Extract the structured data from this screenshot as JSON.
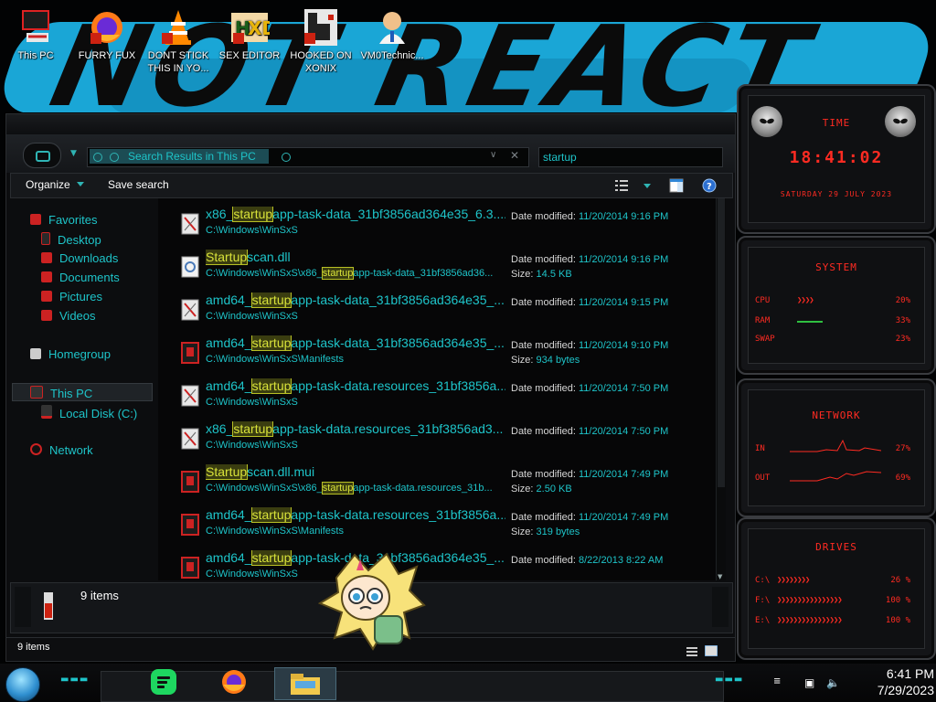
{
  "desktop": {
    "icons": [
      {
        "label": "This PC"
      },
      {
        "label": "FURRY FUX"
      },
      {
        "label": "DONT STICK THIS IN YO..."
      },
      {
        "label": "SEX EDITOR"
      },
      {
        "label": "HOOKED ON XONIX"
      },
      {
        "label": "VM0Technic..."
      }
    ]
  },
  "explorer": {
    "address_text": "Search Results in This PC",
    "search_value": "startup",
    "toolbar": {
      "organize": "Organize",
      "save_search": "Save search"
    },
    "nav": {
      "favorites": "Favorites",
      "desktop": "Desktop",
      "downloads": "Downloads",
      "documents": "Documents",
      "pictures": "Pictures",
      "videos": "Videos",
      "homegroup": "Homegroup",
      "this_pc": "This PC",
      "local_disk": "Local Disk (C:)",
      "network": "Network"
    },
    "labels": {
      "date_modified": "Date modified:",
      "size": "Size:"
    },
    "results": [
      {
        "pre": "x86_",
        "hl": "startup",
        "post": "app-task-data_31bf3856ad364e35_6.3....",
        "path_pre": "C:\\Windows\\WinSxS",
        "path_hl": "",
        "path_post": "",
        "date": "11/20/2014 9:16 PM",
        "size": ""
      },
      {
        "pre": "",
        "hl": "Startup",
        "post": "scan.dll",
        "path_pre": "C:\\Windows\\WinSxS\\x86_",
        "path_hl": "startup",
        "path_post": "app-task-data_31bf3856ad36...",
        "date": "11/20/2014 9:16 PM",
        "size": "14.5 KB"
      },
      {
        "pre": "amd64_",
        "hl": "startup",
        "post": "app-task-data_31bf3856ad364e35_...",
        "path_pre": "C:\\Windows\\WinSxS",
        "path_hl": "",
        "path_post": "",
        "date": "11/20/2014 9:15 PM",
        "size": ""
      },
      {
        "pre": "amd64_",
        "hl": "startup",
        "post": "app-task-data_31bf3856ad364e35_...",
        "path_pre": "C:\\Windows\\WinSxS\\Manifests",
        "path_hl": "",
        "path_post": "",
        "date": "11/20/2014 9:10 PM",
        "size": "934 bytes"
      },
      {
        "pre": "amd64_",
        "hl": "startup",
        "post": "app-task-data.resources_31bf3856a...",
        "path_pre": "C:\\Windows\\WinSxS",
        "path_hl": "",
        "path_post": "",
        "date": "11/20/2014 7:50 PM",
        "size": ""
      },
      {
        "pre": "x86_",
        "hl": "startup",
        "post": "app-task-data.resources_31bf3856ad3...",
        "path_pre": "C:\\Windows\\WinSxS",
        "path_hl": "",
        "path_post": "",
        "date": "11/20/2014 7:50 PM",
        "size": ""
      },
      {
        "pre": "",
        "hl": "Startup",
        "post": "scan.dll.mui",
        "path_pre": "C:\\Windows\\WinSxS\\x86_",
        "path_hl": "startup",
        "path_post": "app-task-data.resources_31b...",
        "date": "11/20/2014 7:49 PM",
        "size": "2.50 KB"
      },
      {
        "pre": "amd64_",
        "hl": "startup",
        "post": "app-task-data.resources_31bf3856a...",
        "path_pre": "C:\\Windows\\WinSxS\\Manifests",
        "path_hl": "",
        "path_post": "",
        "date": "11/20/2014 7:49 PM",
        "size": "319 bytes"
      },
      {
        "pre": "amd64_",
        "hl": "startup",
        "post": "app-task-data_31bf3856ad364e35_...",
        "path_pre": "C:\\Windows\\WinSxS",
        "path_hl": "",
        "path_post": "",
        "date": "8/22/2013 8:22 AM",
        "size": ""
      }
    ],
    "details_count": "9 items",
    "status_count": "9 items"
  },
  "gadgets": {
    "time": {
      "title": "TIME",
      "clock": "18:41:02",
      "date": "SATURDAY 29 JULY 2023"
    },
    "system": {
      "title": "SYSTEM",
      "rows": [
        {
          "label": "CPU",
          "pct": "20%"
        },
        {
          "label": "RAM",
          "pct": "33%"
        },
        {
          "label": "SWAP",
          "pct": "23%"
        }
      ]
    },
    "network": {
      "title": "NETWORK",
      "rows": [
        {
          "label": "IN",
          "pct": "27%"
        },
        {
          "label": "OUT",
          "pct": "69%"
        }
      ]
    },
    "drives": {
      "title": "DRIVES",
      "rows": [
        {
          "label": "C:\\",
          "pct": "26 %"
        },
        {
          "label": "F:\\",
          "pct": "100 %"
        },
        {
          "label": "E:\\",
          "pct": "100 %"
        }
      ]
    }
  },
  "taskbar": {
    "time": "6:41 PM",
    "date": "7/29/2023"
  },
  "colors": {
    "accent": "#1ec4c9",
    "highlight": "#d8e23a",
    "gadget_red": "#ff2b22",
    "wallpaper_blue": "#1aa6d6"
  }
}
